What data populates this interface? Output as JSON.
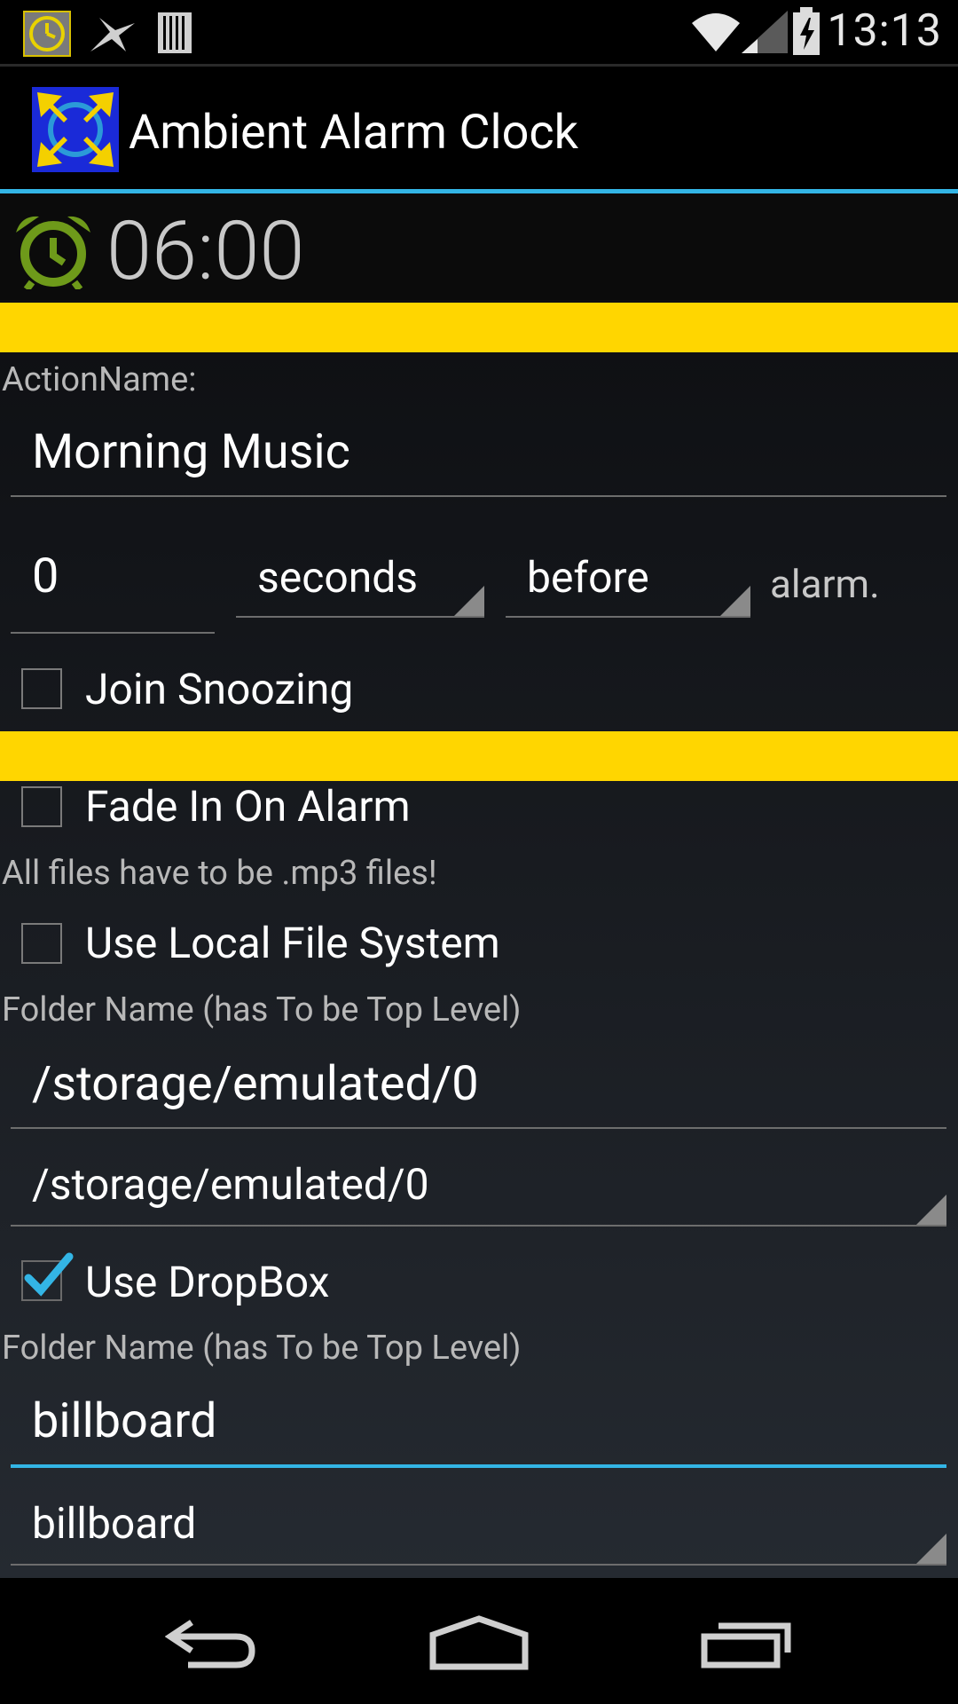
{
  "status_bar": {
    "notification_icons": [
      "clock-app-icon",
      "ninja-star-icon",
      "barcode-icon"
    ],
    "time": "13:13",
    "indicators": [
      "wifi-icon",
      "signal-icon",
      "battery-charging-icon"
    ]
  },
  "action_bar": {
    "app_icon": "app-logo-icon",
    "title": "Ambient Alarm Clock"
  },
  "alarm": {
    "icon": "alarm-clock-icon",
    "time": "06:00"
  },
  "action": {
    "name_label": "ActionName:",
    "name_value": "Morning Music",
    "offset_value": "0",
    "unit_selected": "seconds",
    "relation_selected": "before",
    "suffix": "alarm.",
    "join_snoozing_label": "Join Snoozing",
    "join_snoozing_checked": false
  },
  "music": {
    "fade_in_label": "Fade In On Alarm",
    "fade_in_checked": false,
    "mp3_note": "All files have to be .mp3 files!",
    "local_fs_label": "Use Local File System",
    "local_fs_checked": false,
    "local_folder_label": "Folder Name (has To be Top Level)",
    "local_folder_value": "/storage/emulated/0",
    "local_folder_selected": "/storage/emulated/0",
    "dropbox_label": "Use DropBox",
    "dropbox_checked": true,
    "dropbox_folder_label": "Folder Name (has To be Top Level)",
    "dropbox_folder_value": "billboard",
    "dropbox_folder_selected": "billboard"
  },
  "nav_bar": {
    "buttons": [
      "back-icon",
      "home-icon",
      "recents-icon"
    ]
  },
  "colors": {
    "accent": "#33b5e5",
    "section_bar": "#ffd600",
    "alarm_icon": "#6e9a1a"
  }
}
